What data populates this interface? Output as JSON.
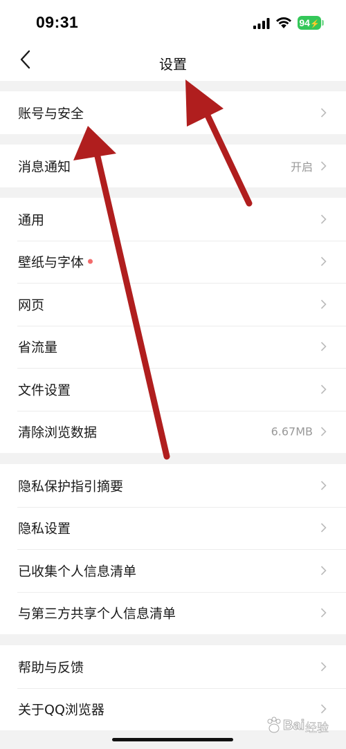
{
  "status_bar": {
    "time": "09:31",
    "battery": "94"
  },
  "nav": {
    "title": "设置"
  },
  "groups": [
    {
      "rows": [
        {
          "label": "账号与安全",
          "value": ""
        }
      ]
    },
    {
      "rows": [
        {
          "label": "消息通知",
          "value": "开启"
        }
      ]
    },
    {
      "rows": [
        {
          "label": "通用",
          "value": ""
        },
        {
          "label": "壁纸与字体",
          "value": ""
        },
        {
          "label": "网页",
          "value": ""
        },
        {
          "label": "省流量",
          "value": ""
        },
        {
          "label": "文件设置",
          "value": ""
        },
        {
          "label": "清除浏览数据",
          "value": "6.67MB"
        }
      ]
    },
    {
      "rows": [
        {
          "label": "隐私保护指引摘要",
          "value": ""
        },
        {
          "label": "隐私设置",
          "value": ""
        },
        {
          "label": "已收集个人信息清单",
          "value": ""
        },
        {
          "label": "与第三方共享个人信息清单",
          "value": ""
        }
      ]
    },
    {
      "rows": [
        {
          "label": "帮助与反馈",
          "value": ""
        },
        {
          "label": "关于QQ浏览器",
          "value": ""
        }
      ]
    }
  ],
  "watermark": {
    "brand": "Bai",
    "sub": "经验"
  },
  "colors": {
    "accent_battery": "#34c759",
    "arrow_red": "#b01e1e",
    "badge_dot": "#f26b6b",
    "value_gray": "#999999",
    "separator_bg": "#f2f2f2"
  }
}
